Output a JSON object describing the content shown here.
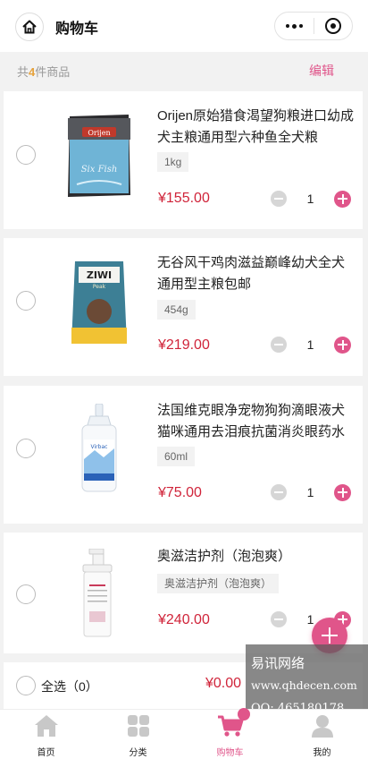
{
  "header": {
    "title": "购物车"
  },
  "summary": {
    "prefix": "共",
    "count": "4",
    "suffix": "件商品",
    "edit_label": "编辑"
  },
  "items": [
    {
      "name": "Orijen原始猎食渴望狗粮进口幼成犬主粮通用型六种鱼全犬粮",
      "spec": "1kg",
      "price": "¥155.00",
      "qty": "1"
    },
    {
      "name": "无谷风干鸡肉滋益巅峰幼犬全犬通用型主粮包邮",
      "spec": "454g",
      "price": "¥219.00",
      "qty": "1"
    },
    {
      "name": "法国维克眼净宠物狗狗滴眼液犬猫咪通用去泪痕抗菌消炎眼药水60ml",
      "spec": "60ml",
      "price": "¥75.00",
      "qty": "1"
    },
    {
      "name": "奥滋洁护剂（泡泡爽）",
      "spec": "奥滋洁护剂（泡泡爽）",
      "price": "¥240.00",
      "qty": "1"
    }
  ],
  "product_art": [
    {
      "brand": "Orijen",
      "sub": "Six Fish"
    },
    {
      "brand": "ZIWI",
      "sub": "Peak"
    },
    {
      "brand": "Virbac"
    },
    {
      "brand": ""
    }
  ],
  "checkout": {
    "select_all_label": "全选（0）",
    "total": "¥0.00"
  },
  "watermark": {
    "line1": "易讯网络",
    "line2": "www.qhdecen.com",
    "line3": "QQ: 465180178"
  },
  "tabs": [
    {
      "label": "首页",
      "icon": "home-icon"
    },
    {
      "label": "分类",
      "icon": "category-grid-icon"
    },
    {
      "label": "购物车",
      "icon": "cart-icon",
      "active": true
    },
    {
      "label": "我的",
      "icon": "user-icon"
    }
  ],
  "colors": {
    "accent": "#e0558a",
    "price": "#d0243a",
    "count": "#e6a23c"
  }
}
